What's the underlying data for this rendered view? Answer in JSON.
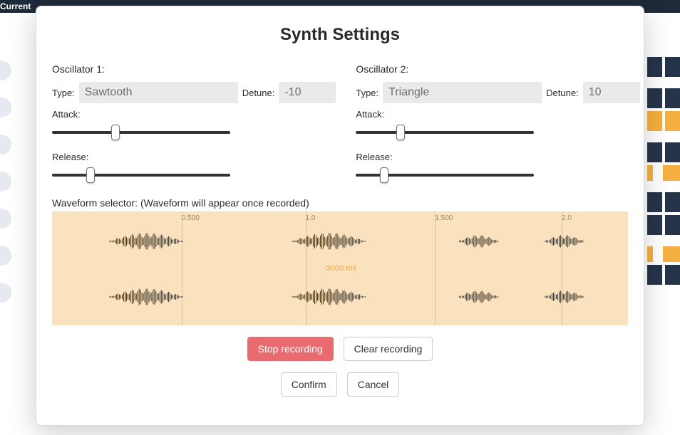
{
  "topbar": {
    "label": "Current"
  },
  "modal": {
    "title": "Synth Settings",
    "osc1": {
      "heading": "Oscillator 1:",
      "type_label": "Type:",
      "type_value": "Sawtooth",
      "detune_label": "Detune:",
      "detune_value": "-10",
      "attack_label": "Attack:",
      "attack_value": 35,
      "release_label": "Release:",
      "release_value": 20
    },
    "osc2": {
      "heading": "Oscillator 2:",
      "type_label": "Type:",
      "type_value": "Triangle",
      "detune_label": "Detune:",
      "detune_value": "10",
      "attack_label": "Attack:",
      "attack_value": 24,
      "release_label": "Release:",
      "release_value": 14
    },
    "waveform": {
      "label": "Waveform selector: (Waveform will appear once recorded)",
      "ticks": [
        "0.500",
        "1.0",
        "1.500",
        "2.0"
      ],
      "center_text": "-3000 ms"
    },
    "buttons": {
      "stop": "Stop recording",
      "clear": "Clear recording",
      "confirm": "Confirm",
      "cancel": "Cancel"
    }
  }
}
